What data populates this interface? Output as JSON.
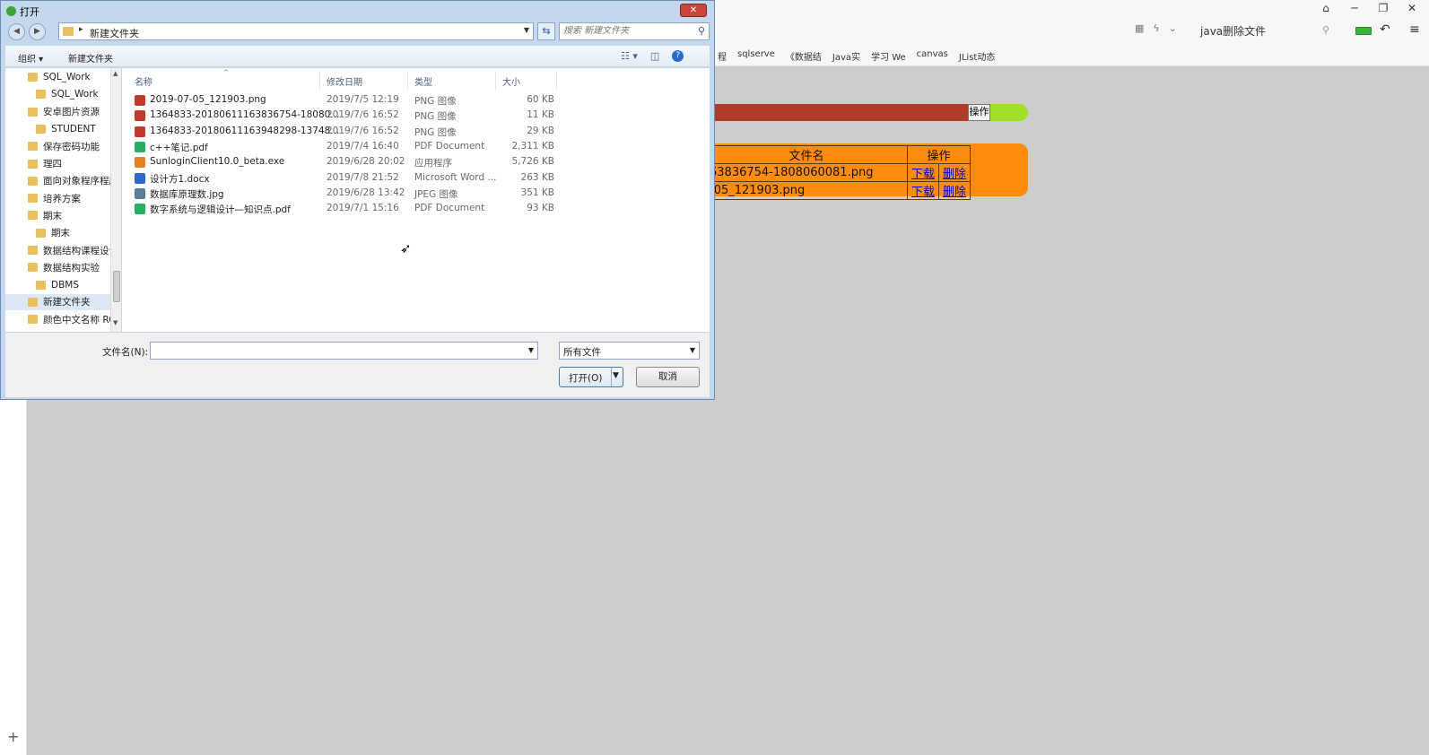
{
  "browser": {
    "address_text": "java删除文件",
    "bookmarks": [
      "程",
      "sqlserve",
      "《数据结",
      "Java实",
      "学习 We",
      "canvas",
      "JList动态"
    ],
    "plus_label": "+"
  },
  "page": {
    "operate_button": "操作",
    "table": {
      "headers": [
        "文件名",
        "操作"
      ],
      "rows": [
        {
          "name": "63836754-1808060081.png",
          "download": "下载",
          "delete": "删除"
        },
        {
          "name": "-05_121903.png",
          "download": "下载",
          "delete": "删除"
        }
      ]
    }
  },
  "dialog": {
    "title": "打开",
    "path": "新建文件夹",
    "search_placeholder": "搜索 新建文件夹",
    "organize_label": "组织 ▾",
    "new_folder_label": "新建文件夹",
    "tree": [
      {
        "label": "SQL_Work",
        "indent": 0,
        "selected": false
      },
      {
        "label": "SQL_Work",
        "indent": 1,
        "selected": false
      },
      {
        "label": "安卓图片资源",
        "indent": 0,
        "selected": false
      },
      {
        "label": "STUDENT",
        "indent": 1,
        "selected": false
      },
      {
        "label": "保存密码功能",
        "indent": 0,
        "selected": false
      },
      {
        "label": "理四",
        "indent": 0,
        "selected": false
      },
      {
        "label": "面向对象程序程序",
        "indent": 0,
        "selected": false
      },
      {
        "label": "培养方案",
        "indent": 0,
        "selected": false
      },
      {
        "label": "期末",
        "indent": 0,
        "selected": false
      },
      {
        "label": "期末",
        "indent": 1,
        "selected": false
      },
      {
        "label": "数据结构课程设计",
        "indent": 0,
        "selected": false
      },
      {
        "label": "数据结构实验",
        "indent": 0,
        "selected": false
      },
      {
        "label": "DBMS",
        "indent": 1,
        "selected": false
      },
      {
        "label": "新建文件夹",
        "indent": 0,
        "selected": true
      },
      {
        "label": "颜色中文名称 RC",
        "indent": 0,
        "selected": false
      }
    ],
    "columns": [
      "名称",
      "修改日期",
      "类型",
      "大小"
    ],
    "files": [
      {
        "name": "2019-07-05_121903.png",
        "date": "2019/7/5 12:19",
        "type": "PNG 图像",
        "size": "60 KB",
        "icon_color": "#c0392b"
      },
      {
        "name": "1364833-20180611163836754-18080...",
        "date": "2019/7/6 16:52",
        "type": "PNG 图像",
        "size": "11 KB",
        "icon_color": "#c0392b"
      },
      {
        "name": "1364833-20180611163948298-13748...",
        "date": "2019/7/6 16:52",
        "type": "PNG 图像",
        "size": "29 KB",
        "icon_color": "#c0392b"
      },
      {
        "name": "c++笔记.pdf",
        "date": "2019/7/4 16:40",
        "type": "PDF Document",
        "size": "2,311 KB",
        "icon_color": "#27ae60"
      },
      {
        "name": "SunloginClient10.0_beta.exe",
        "date": "2019/6/28 20:02",
        "type": "应用程序",
        "size": "5,726 KB",
        "icon_color": "#e67e22"
      },
      {
        "name": "设计方1.docx",
        "date": "2019/7/8 21:52",
        "type": "Microsoft Word ...",
        "size": "263 KB",
        "icon_color": "#2a6ac8"
      },
      {
        "name": "数据库原理数.jpg",
        "date": "2019/6/28 13:42",
        "type": "JPEG 图像",
        "size": "351 KB",
        "icon_color": "#5a7aa0"
      },
      {
        "name": "数字系统与逻辑设计—知识点.pdf",
        "date": "2019/7/1 15:16",
        "type": "PDF Document",
        "size": "93 KB",
        "icon_color": "#27ae60"
      }
    ],
    "filename_label": "文件名(N):",
    "filename_value": "",
    "filter_value": "所有文件",
    "open_label": "打开(O)",
    "cancel_label": "取消"
  }
}
